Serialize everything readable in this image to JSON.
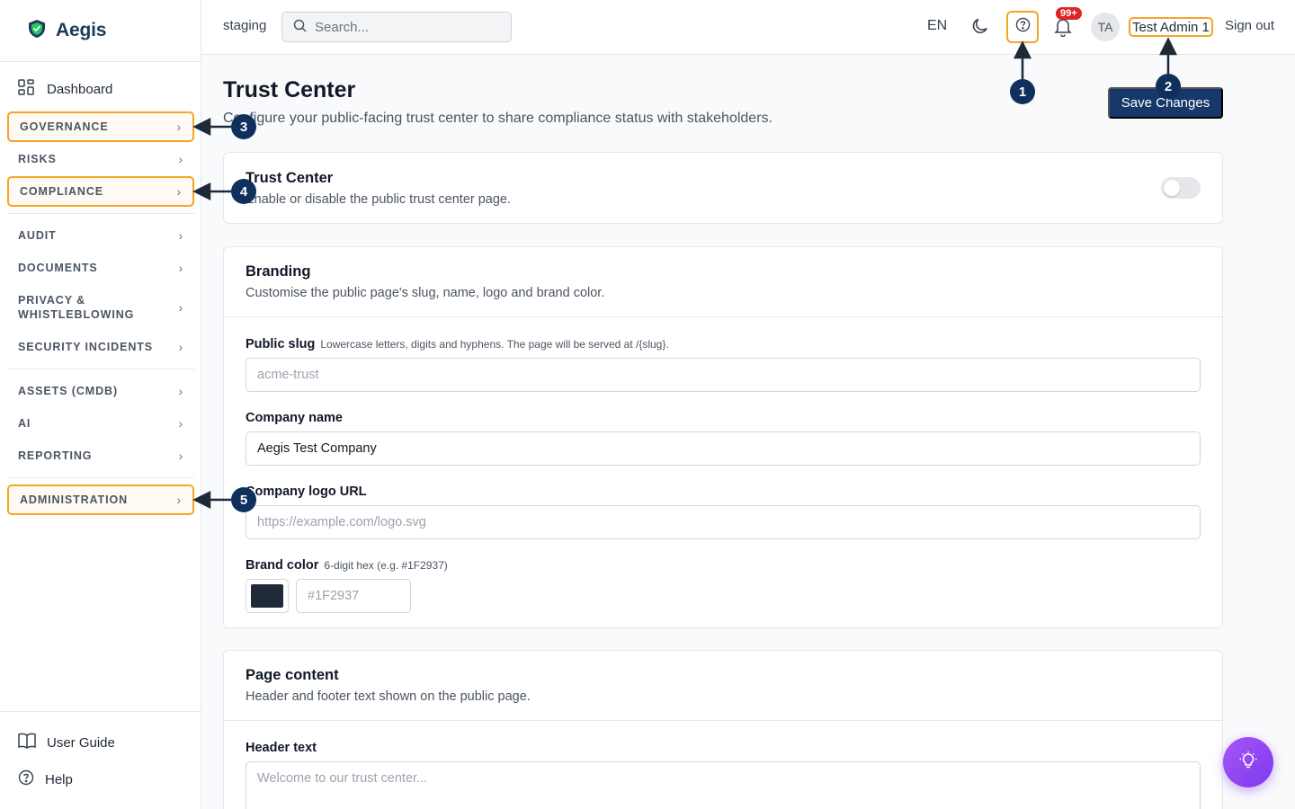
{
  "app": {
    "name": "Aegis",
    "environment": "staging"
  },
  "search": {
    "placeholder": "Search..."
  },
  "header": {
    "language": "EN",
    "notification_count": "99+",
    "avatar_initials": "TA",
    "user_name": "Test Admin 1",
    "sign_out": "Sign out"
  },
  "sidebar": {
    "dashboard": "Dashboard",
    "items": [
      {
        "label": "GOVERNANCE"
      },
      {
        "label": "RISKS"
      },
      {
        "label": "COMPLIANCE"
      },
      {
        "label": "AUDIT"
      },
      {
        "label": "DOCUMENTS"
      },
      {
        "label": "PRIVACY &"
      },
      {
        "label": "WHISTLEBLOWING"
      },
      {
        "label": "SECURITY INCIDENTS"
      },
      {
        "label": "ASSETS (CMDB)"
      },
      {
        "label": "AI"
      },
      {
        "label": "REPORTING"
      },
      {
        "label": "ADMINISTRATION"
      }
    ],
    "user_guide": "User Guide",
    "help": "Help"
  },
  "page": {
    "title": "Trust Center",
    "subtitle": "Configure your public-facing trust center to share compliance status with stakeholders.",
    "save_label": "Save Changes"
  },
  "trust_card": {
    "title": "Trust Center",
    "description": "Enable or disable the public trust center page.",
    "enabled": false
  },
  "branding": {
    "title": "Branding",
    "description": "Customise the public page's slug, name, logo and brand color.",
    "slug_label": "Public slug",
    "slug_hint": "Lowercase letters, digits and hyphens. The page will be served at /{slug}.",
    "slug_placeholder": "acme-trust",
    "company_label": "Company name",
    "company_value": "Aegis Test Company",
    "logo_label": "Company logo URL",
    "logo_placeholder": "https://example.com/logo.svg",
    "color_label": "Brand color",
    "color_hint": "6-digit hex (e.g. #1F2937)",
    "color_placeholder": "#1F2937",
    "color_value": "#1F2937"
  },
  "page_content": {
    "title": "Page content",
    "description": "Header and footer text shown on the public page.",
    "header_label": "Header text",
    "header_placeholder": "Welcome to our trust center..."
  },
  "annotations": [
    "1",
    "2",
    "3",
    "4",
    "5"
  ],
  "colors": {
    "highlight": "#f5a524",
    "marker": "#0f2f5c",
    "primary": "#17386a",
    "fab": "#7c3aed"
  }
}
